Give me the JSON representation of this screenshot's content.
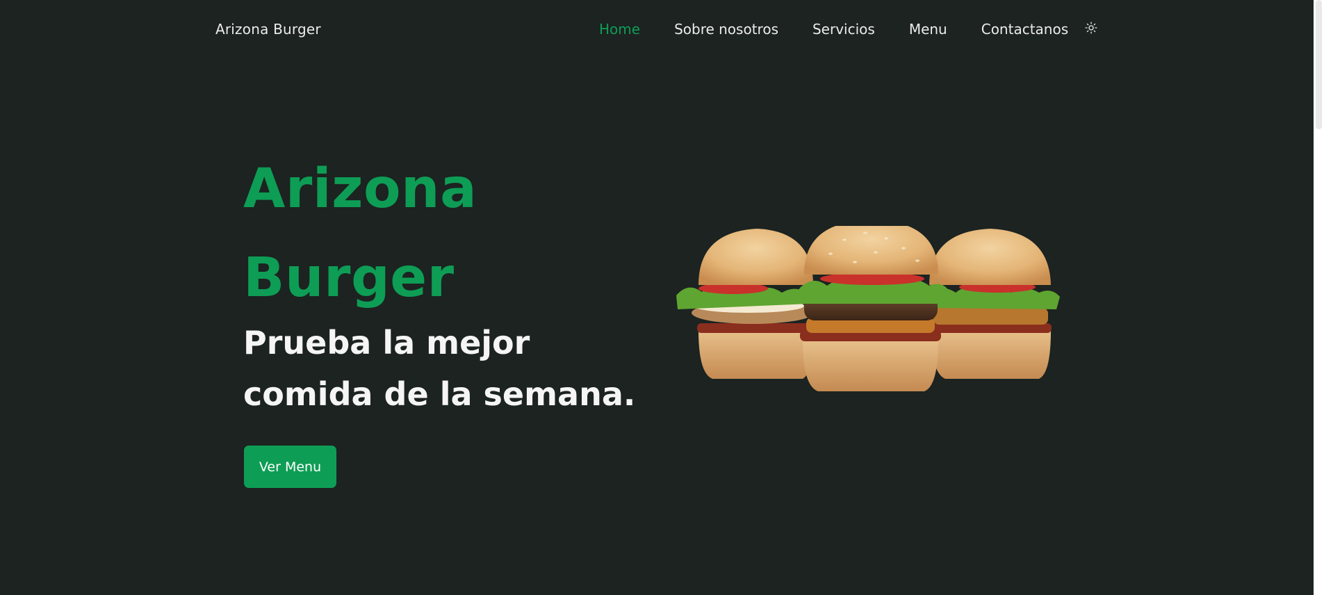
{
  "header": {
    "brand": "Arizona Burger",
    "nav": [
      {
        "label": "Home",
        "active": true
      },
      {
        "label": "Sobre nosotros",
        "active": false
      },
      {
        "label": "Servicios",
        "active": false
      },
      {
        "label": "Menu",
        "active": false
      },
      {
        "label": "Contactanos",
        "active": false
      }
    ],
    "theme_toggle_icon": "sun-icon"
  },
  "hero": {
    "title_line1": "Arizona",
    "title_line2": "Burger",
    "subtitle": "Prueba la mejor comida de la semana.",
    "cta_label": "Ver Menu",
    "image_alt": "burgers"
  },
  "colors": {
    "background": "#1c2321",
    "accent": "#0e9d55",
    "text": "#f2f2f2"
  }
}
